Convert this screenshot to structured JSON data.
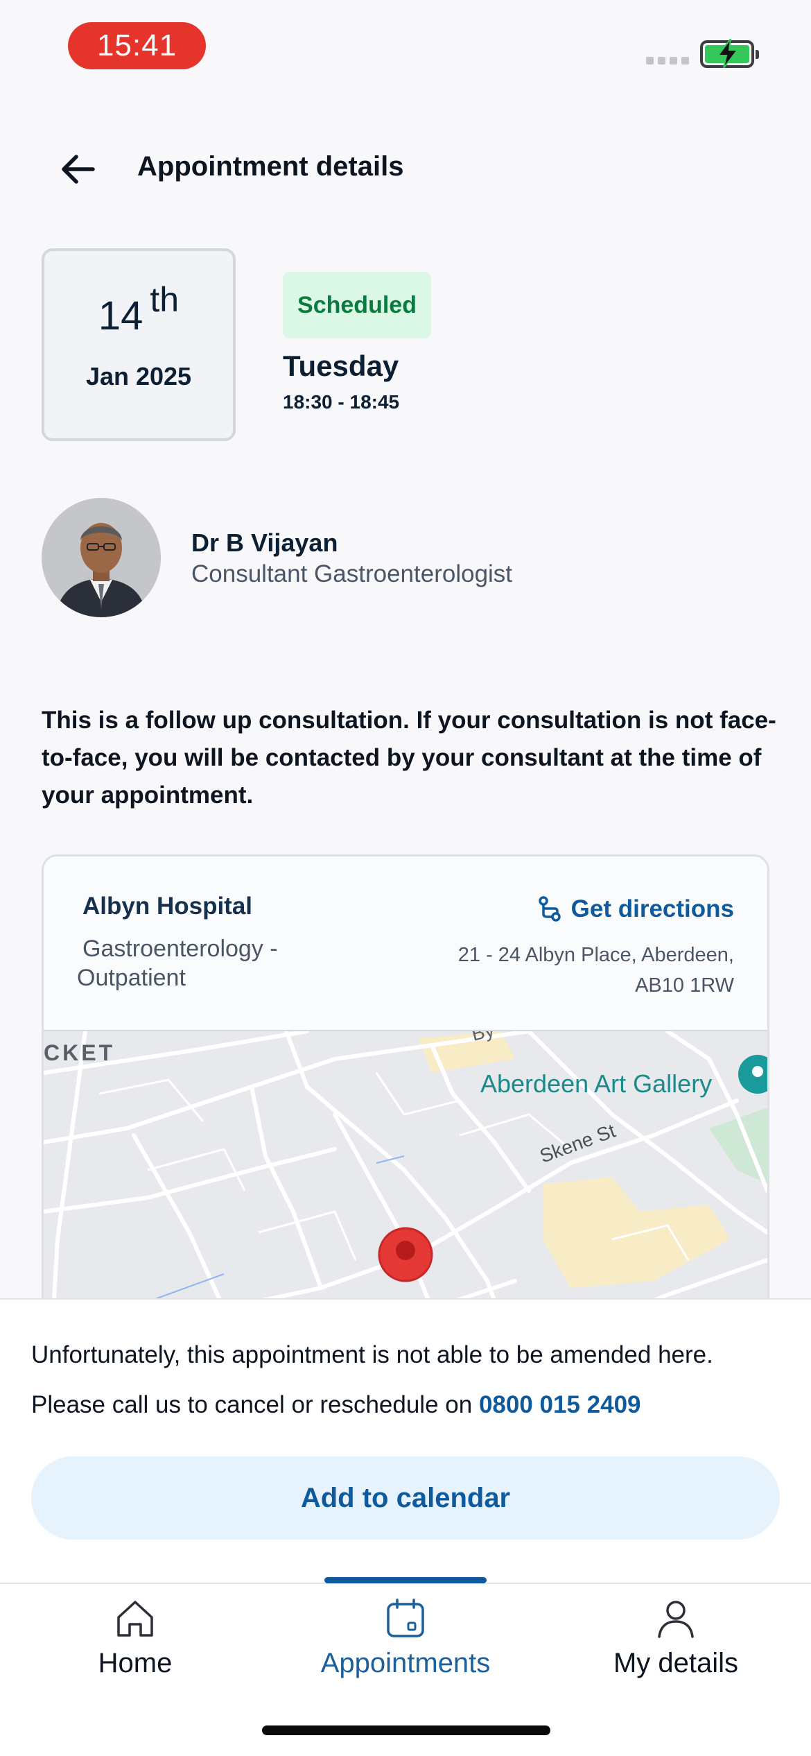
{
  "status_bar": {
    "time": "15:41"
  },
  "header": {
    "title": "Appointment details",
    "back_icon": "arrow-left-icon"
  },
  "appointment": {
    "day": "14",
    "day_suffix": "th",
    "month_year": "Jan 2025",
    "status": "Scheduled",
    "weekday": "Tuesday",
    "time_range": "18:30 - 18:45",
    "status_color": "#0b7a3e",
    "status_bg": "#dbf7e6"
  },
  "doctor": {
    "name": "Dr B Vijayan",
    "role": "Consultant Gastroenterologist"
  },
  "notice": "This is a follow up consultation. If your consultation is not face-to-face, you will be contacted by your consultant at the time of your appointment.",
  "location": {
    "hospital": "Albyn Hospital",
    "department": "Gastroenterology - Outpatient",
    "directions_label": "Get directions",
    "directions_icon": "route-icon",
    "address_line1": "21 - 24 Albyn Place, Aberdeen,",
    "address_line2": "AB10 1RW",
    "map": {
      "label_gallery": "Aberdeen Art Gallery",
      "label_street": "Skene St",
      "label_partial_left": "CKET",
      "label_partial_top": "By",
      "pin_icon": "map-pin-icon"
    }
  },
  "sheet": {
    "line1": "Unfortunately, this appointment is not able to be amended here.",
    "line2_prefix": "Please call us to cancel or reschedule on ",
    "phone": "0800 015 2409",
    "calendar_button": "Add to calendar"
  },
  "tabs": [
    {
      "label": "Home",
      "icon": "home-icon",
      "active": false
    },
    {
      "label": "Appointments",
      "icon": "calendar-icon",
      "active": true
    },
    {
      "label": "My details",
      "icon": "person-icon",
      "active": false
    }
  ],
  "colors": {
    "accent": "#0e5a9c",
    "time_pill": "#e5342b",
    "battery": "#34c759"
  }
}
